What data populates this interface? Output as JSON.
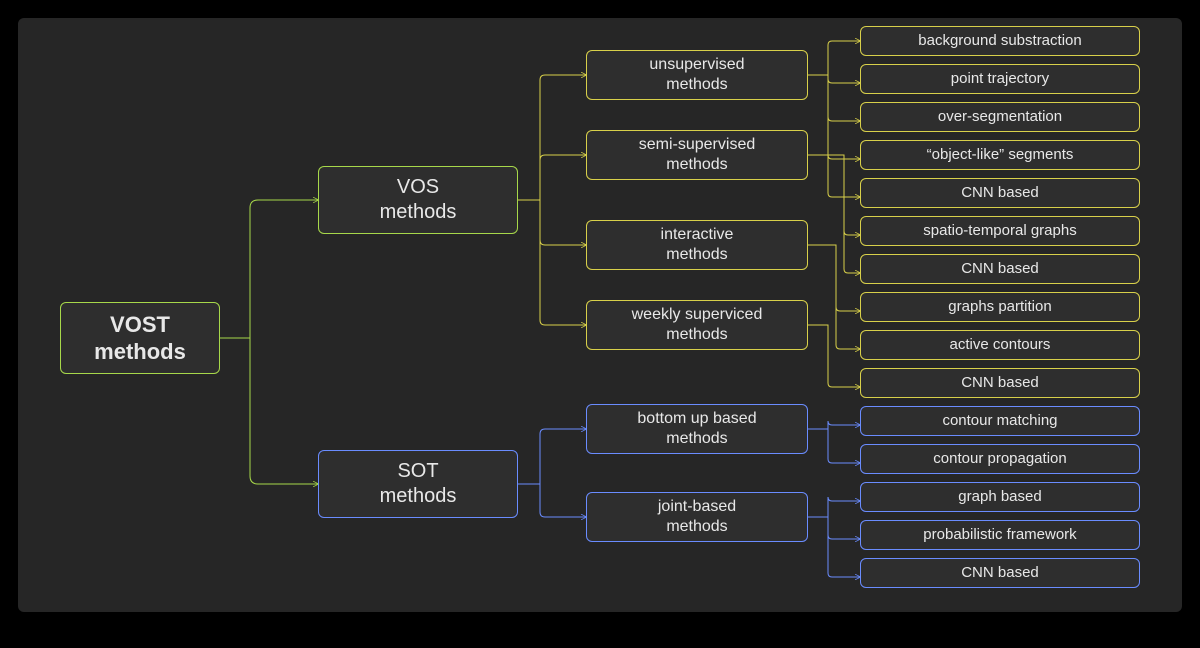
{
  "root": {
    "label": "VOST\nmethods"
  },
  "level1": {
    "vos": "VOS\nmethods",
    "sot": "SOT\nmethods"
  },
  "vos_sub": {
    "unsupervised": "unsupervised\nmethods",
    "semi": "semi-supervised\nmethods",
    "interactive": "interactive\nmethods",
    "weekly": "weekly superviced\nmethods"
  },
  "sot_sub": {
    "bottom": "bottom up based\nmethods",
    "joint": "joint-based\nmethods"
  },
  "leaves": {
    "l0": "background substraction",
    "l1": "point trajectory",
    "l2": "over-segmentation",
    "l3": "“object-like” segments",
    "l4": "CNN based",
    "l5": "spatio-temporal graphs",
    "l6": "CNN based",
    "l7": "graphs partition",
    "l8": "active contours",
    "l9": "CNN based",
    "l10": "contour matching",
    "l11": "contour propagation",
    "l12": "graph based",
    "l13": "probabilistic framework",
    "l14": "CNN based"
  },
  "colors": {
    "green": "#a7d84a",
    "yellow": "#d8d04a",
    "blue": "#6a8cff",
    "bg": "#262626",
    "text": "#e8e8e8"
  }
}
